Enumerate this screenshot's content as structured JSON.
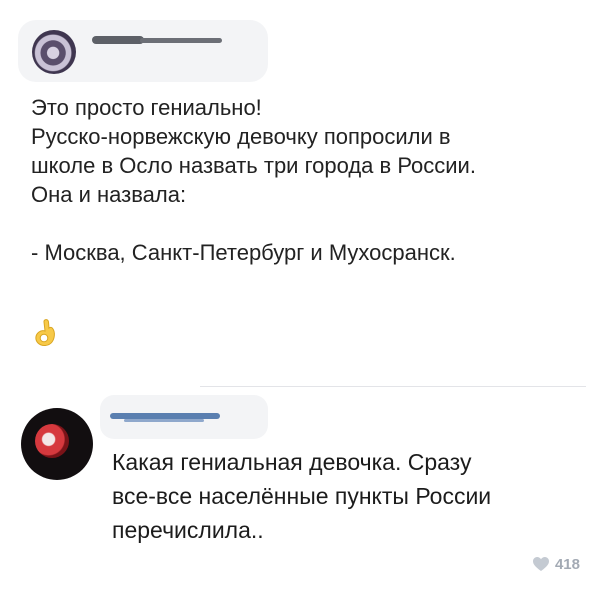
{
  "post": {
    "lines": [
      "Это просто гениально!",
      "Русско-норвежскую девочку попросили в",
      "школе в Осло назвать три города в России.",
      "Она и назвала:",
      "- Москва, Санкт-Петербург и Мухосранск."
    ],
    "emoji": "👌"
  },
  "comment": {
    "lines": [
      "Какая гениальная девочка. Сразу",
      "все-все населённые пункты России",
      "перечислила.."
    ],
    "likes": "418"
  },
  "colors": {
    "text": "#222222",
    "like_gray": "#a3aab4",
    "divider": "#e3e4e8",
    "emoji_yellow": "#f7c948"
  }
}
